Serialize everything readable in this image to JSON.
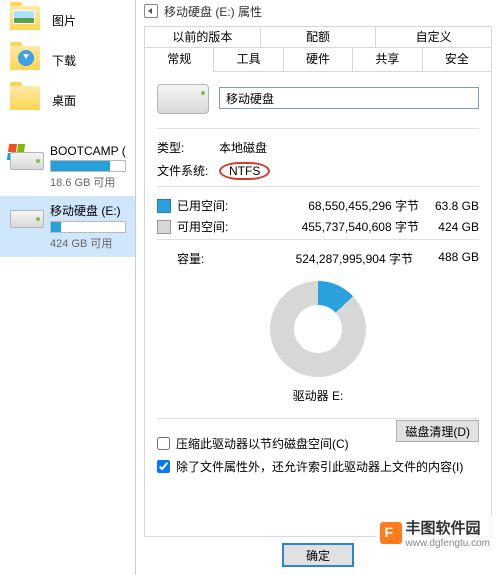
{
  "sidebar": {
    "items": [
      {
        "label": "图片"
      },
      {
        "label": "下载"
      },
      {
        "label": "桌面"
      }
    ],
    "drives": [
      {
        "title": "BOOTCAMP (",
        "sub": "18.6 GB 可用",
        "fill_pct": 80,
        "selected": false,
        "has_winlogo": true
      },
      {
        "title": "移动硬盘 (E:)",
        "sub": "424 GB 可用",
        "fill_pct": 14,
        "selected": true,
        "has_winlogo": false
      }
    ]
  },
  "dialog": {
    "title": "移动硬盘 (E:) 属性",
    "tabs_top": [
      "以前的版本",
      "配额",
      "自定义"
    ],
    "tabs_bottom": [
      "常规",
      "工具",
      "硬件",
      "共享",
      "安全"
    ],
    "active_tab": "常规",
    "name_value": "移动硬盘",
    "type_label": "类型:",
    "type_value": "本地磁盘",
    "fs_label": "文件系统:",
    "fs_value": "NTFS",
    "used": {
      "label": "已用空间:",
      "bytes": "68,550,455,296 字节",
      "gb": "63.8 GB"
    },
    "free": {
      "label": "可用空间:",
      "bytes": "455,737,540,608 字节",
      "gb": "424 GB"
    },
    "capacity": {
      "label": "容量:",
      "bytes": "524,287,995,904 字节",
      "gb": "488 GB"
    },
    "drive_label": "驱动器 E:",
    "cleanup_btn": "磁盘清理(D)",
    "check_compress": "压缩此驱动器以节约磁盘空间(C)",
    "check_index": "除了文件属性外，还允许索引此驱动器上文件的内容(I)",
    "check_index_checked": true,
    "ok": "确定"
  },
  "watermark": {
    "brand": "丰图软件园",
    "url": "www.dgfengtu.com"
  }
}
